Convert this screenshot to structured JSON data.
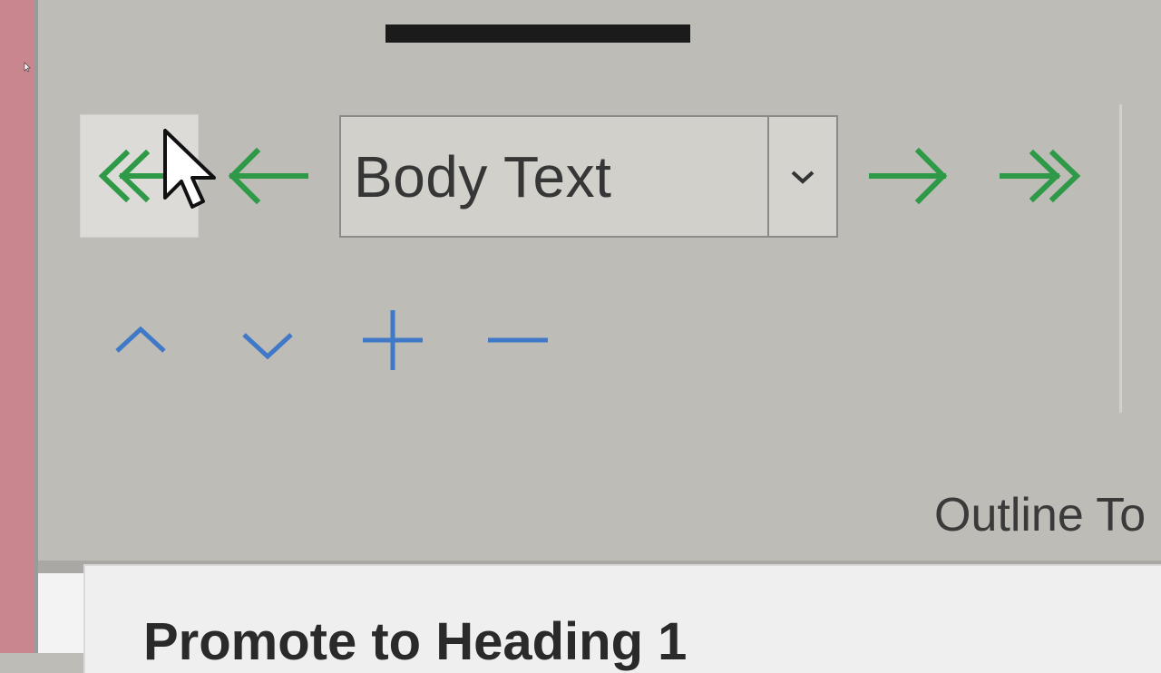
{
  "outline_tools": {
    "style_combo": {
      "value": "Body Text"
    },
    "group_label": "Outline To",
    "buttons": {
      "promote_to_heading_1": "double-left-arrow-icon",
      "promote": "left-arrow-icon",
      "demote": "right-arrow-icon",
      "demote_to_body_text": "double-right-arrow-icon",
      "move_up": "chevron-up-icon",
      "move_down": "chevron-down-icon",
      "expand": "plus-icon",
      "collapse": "minus-icon"
    }
  },
  "tooltip": {
    "title": "Promote to Heading 1"
  },
  "colors": {
    "arrow_green": "#2e9a47",
    "arrow_blue": "#3f79c8",
    "ribbon_bg": "#bebcb6",
    "tooltip_bg": "#efefef",
    "side_strip": "#c9868f"
  }
}
